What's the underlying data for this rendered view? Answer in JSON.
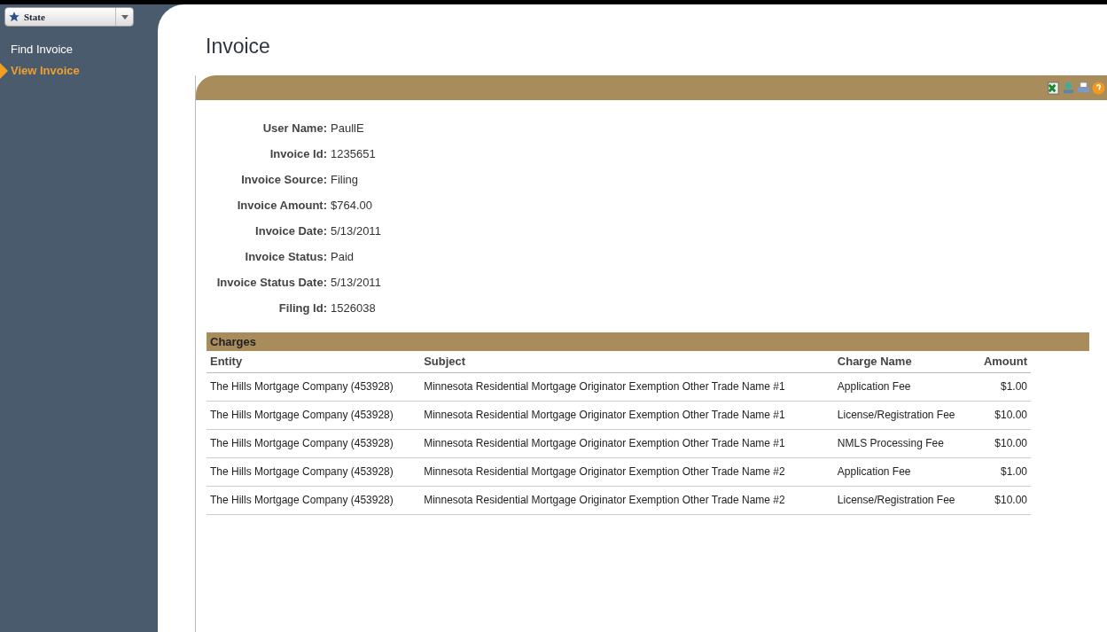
{
  "state_selector": {
    "value": "State"
  },
  "sidebar": {
    "items": [
      {
        "label": "Find Invoice",
        "selected": false
      },
      {
        "label": "View Invoice",
        "selected": true
      }
    ]
  },
  "page_title": "Invoice",
  "details": [
    {
      "label": "User Name:",
      "value": "PaullE"
    },
    {
      "label": "Invoice Id:",
      "value": "1235651"
    },
    {
      "label": "Invoice Source:",
      "value": "Filing"
    },
    {
      "label": "Invoice Amount:",
      "value": "$764.00"
    },
    {
      "label": "Invoice Date:",
      "value": "5/13/2011"
    },
    {
      "label": "Invoice Status:",
      "value": "Paid"
    },
    {
      "label": "Invoice Status Date:",
      "value": "5/13/2011"
    },
    {
      "label": "Filing Id:",
      "value": "1526038"
    }
  ],
  "charges": {
    "title": "Charges",
    "columns": [
      "Entity",
      "Subject",
      "Charge Name",
      "Amount"
    ],
    "rows": [
      [
        "The Hills Mortgage Company (453928)",
        "Minnesota Residential Mortgage Originator Exemption Other Trade Name #1",
        "Application Fee",
        "$1.00"
      ],
      [
        "The Hills Mortgage Company (453928)",
        "Minnesota Residential Mortgage Originator Exemption Other Trade Name #1",
        "License/Registration Fee",
        "$10.00"
      ],
      [
        "The Hills Mortgage Company (453928)",
        "Minnesota Residential Mortgage Originator Exemption Other Trade Name #1",
        "NMLS Processing Fee",
        "$10.00"
      ],
      [
        "The Hills Mortgage Company (453928)",
        "Minnesota Residential Mortgage Originator Exemption Other Trade Name #2",
        "Application Fee",
        "$1.00"
      ],
      [
        "The Hills Mortgage Company (453928)",
        "Minnesota Residential Mortgage Originator Exemption Other Trade Name #2",
        "License/Registration Fee",
        "$10.00"
      ]
    ]
  }
}
